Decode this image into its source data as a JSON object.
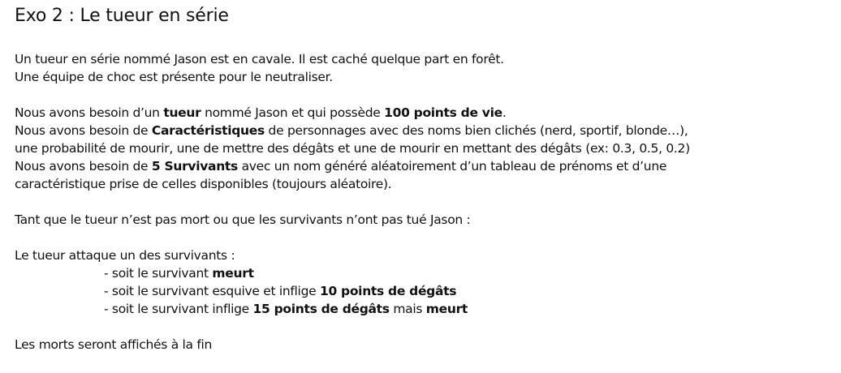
{
  "title": "Exo 2 : Le tueur en série",
  "intro": {
    "line1": "Un tueur en série nommé Jason est en cavale. Il est caché quelque part en forêt.",
    "line2": "Une équipe de choc est présente pour le neutraliser."
  },
  "needs": {
    "killer": {
      "prefix": "Nous avons besoin d’un ",
      "bold1": "tueur",
      "middle": " nommé Jason et qui possède ",
      "bold2": "100 points de vie",
      "suffix": "."
    },
    "traits": {
      "prefix": "Nous avons besoin de ",
      "bold": "Caractéristiques",
      "suffix": " de personnages avec des noms bien clichés (nerd, sportif, blonde…),",
      "line2": "une probabilité de mourir, une de mettre des dégâts et une de mourir en mettant des dégâts (ex: 0.3, 0.5, 0.2)"
    },
    "survivors": {
      "prefix": "Nous avons besoin de ",
      "bold": "5 Survivants",
      "suffix": " avec un nom généré aléatoirement d’un tableau de prénoms et d’une",
      "line2": "caractéristique prise de celles disponibles (toujours aléatoire)."
    }
  },
  "loop": "Tant que le tueur n’est pas mort ou que les survivants n’ont pas tué Jason :",
  "attack": {
    "intro": "Le tueur attaque un des survivants :",
    "option1": {
      "prefix": "- soit le survivant ",
      "bold": "meurt"
    },
    "option2": {
      "prefix": "- soit le survivant esquive et inflige ",
      "bold": "10 points de dégâts"
    },
    "option3": {
      "prefix": "- soit le survivant inflige ",
      "bold": "15 points de dégâts",
      "middle": " mais ",
      "bold2": "meurt"
    }
  },
  "ending": "Les morts seront affichés à la fin"
}
